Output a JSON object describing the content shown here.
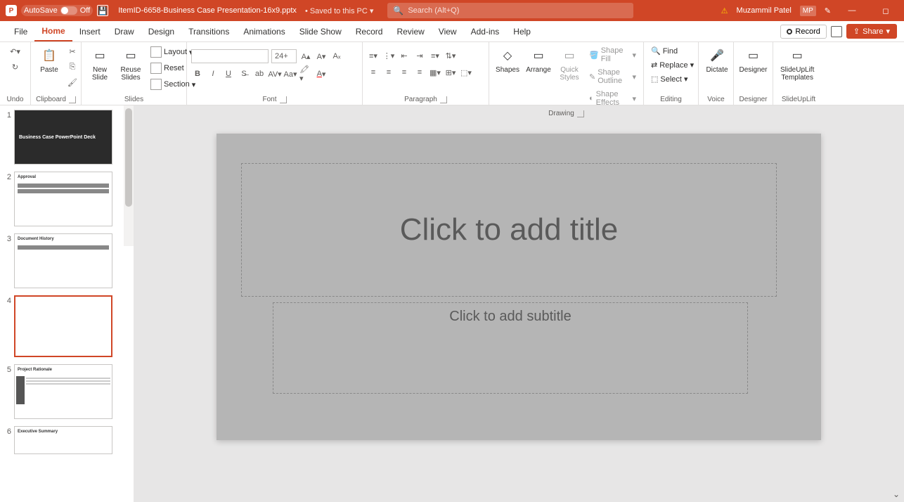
{
  "titlebar": {
    "autosave_label": "AutoSave",
    "autosave_state": "Off",
    "filename": "ItemID-6658-Business Case Presentation-16x9.pptx",
    "save_status": "• Saved to this PC ▾",
    "search_placeholder": "Search (Alt+Q)",
    "user_name": "Muzammil Patel",
    "user_initials": "MP"
  },
  "tabs": {
    "file": "File",
    "home": "Home",
    "insert": "Insert",
    "draw": "Draw",
    "design": "Design",
    "transitions": "Transitions",
    "animations": "Animations",
    "slideshow": "Slide Show",
    "record": "Record",
    "review": "Review",
    "view": "View",
    "addins": "Add-ins",
    "help": "Help",
    "record_btn": "Record",
    "share_btn": "Share"
  },
  "ribbon": {
    "undo": {
      "label": "Undo"
    },
    "clipboard": {
      "paste": "Paste",
      "label": "Clipboard"
    },
    "slides": {
      "new_slide": "New\nSlide",
      "reuse": "Reuse\nSlides",
      "layout": "Layout",
      "reset": "Reset",
      "section": "Section",
      "label": "Slides"
    },
    "font": {
      "size": "24+",
      "label": "Font"
    },
    "paragraph": {
      "label": "Paragraph"
    },
    "drawing": {
      "shapes": "Shapes",
      "arrange": "Arrange",
      "quick": "Quick\nStyles",
      "fill": "Shape Fill",
      "outline": "Shape Outline",
      "effects": "Shape Effects",
      "label": "Drawing"
    },
    "editing": {
      "find": "Find",
      "replace": "Replace",
      "select": "Select",
      "label": "Editing"
    },
    "voice": {
      "dictate": "Dictate",
      "label": "Voice"
    },
    "designer": {
      "designer": "Designer",
      "label": "Designer"
    },
    "slideuplift": {
      "templates": "SlideUpLift\nTemplates",
      "label": "SlideUpLift"
    }
  },
  "thumbnails": [
    {
      "num": "1",
      "title": "Business Case PowerPoint Deck"
    },
    {
      "num": "2",
      "title": "Approval"
    },
    {
      "num": "3",
      "title": "Document History"
    },
    {
      "num": "4",
      "title": ""
    },
    {
      "num": "5",
      "title": "Project Rationale"
    },
    {
      "num": "6",
      "title": "Executive Summary"
    }
  ],
  "slide": {
    "title_placeholder": "Click to add title",
    "subtitle_placeholder": "Click to add subtitle"
  }
}
